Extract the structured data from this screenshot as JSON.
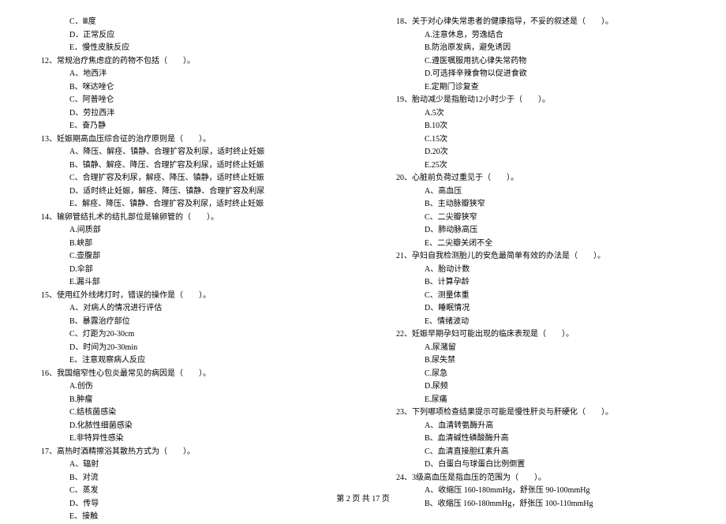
{
  "left": {
    "pre_options": [
      "C．Ⅲ度",
      "D．正常反应",
      "E．慢性皮肤反应"
    ],
    "questions": [
      {
        "num": "12、",
        "text": "常规治疗焦虑症的药物不包括（　　）。",
        "options": [
          "A、地西泮",
          "B、咪达唑仑",
          "C、阿普唑仑",
          "D、劳拉西泮",
          "E、奋乃静"
        ]
      },
      {
        "num": "13、",
        "text": "妊娠期高血压综合征的治疗原则是（　　）。",
        "options": [
          "A、降压、解痉、镇静、合理扩容及利尿，适时终止妊娠",
          "B、镇静、解痉、降压、合理扩容及利尿，适时终止妊娠",
          "C、合理扩容及利尿，解痉、降压、镇静，适时终止妊娠",
          "D、适时终止妊娠，解痉、降压、镇静、合理扩容及利尿",
          "E、解痉、降压、镇静、合理扩容及利尿，适时终止妊娠"
        ]
      },
      {
        "num": "14、",
        "text": "输卵管结扎术的结扎部位是输卵管的（　　）。",
        "options": [
          "A.间质部",
          "B.峡部",
          "C.壶腹部",
          "D.伞部",
          "E.漏斗部"
        ]
      },
      {
        "num": "15、",
        "text": "使用红外线烤灯时，错误的操作是（　　）。",
        "options": [
          "A、对病人的情况进行评估",
          "B、暴露治疗部位",
          "C、灯距为20-30cm",
          "D、时间为20-30min",
          "E、注意观察病人反应"
        ]
      },
      {
        "num": "16、",
        "text": "我国缩窄性心包炎最常见的病因是（　　）。",
        "options": [
          "A.创伤",
          "B.肿瘤",
          "C.结核菌感染",
          "D.化脓性细菌感染",
          "E.非特异性感染"
        ]
      },
      {
        "num": "17、",
        "text": "高热时酒精擦浴其散热方式为（　　）。",
        "options": [
          "A、辐射",
          "B、对流",
          "C、蒸发",
          "D、传导",
          "E、接触"
        ]
      }
    ]
  },
  "right": {
    "questions": [
      {
        "num": "18、",
        "text": "关于对心律失常患者的健康指导，不妥的叙述是（　　）。",
        "options": [
          "A.注意休息，劳逸结合",
          "B.防治原发病，避免诱因",
          "C.遵医嘱服用抗心律失常药物",
          "D.可选择辛辣食物以促进食欲",
          "E.定期门诊复查"
        ]
      },
      {
        "num": "19、",
        "text": "胎动减少是指胎动12小时少于（　　）。",
        "options": [
          "A.5次",
          "B.10次",
          "C.15次",
          "D.20次",
          "E.25次"
        ]
      },
      {
        "num": "20、",
        "text": "心脏前负荷过重见于（　　）。",
        "options": [
          "A、高血压",
          "B、主动脉瓣狭窄",
          "C、二尖瓣狭窄",
          "D、肺动脉高压",
          "E、二尖瓣关闭不全"
        ]
      },
      {
        "num": "21、",
        "text": "孕妇自我检测胎儿的安危最简单有效的办法是（　　）。",
        "options": [
          "A、胎动计数",
          "B、计算孕龄",
          "C、测量体重",
          "D、睡眠情况",
          "E、情绪波动"
        ]
      },
      {
        "num": "22、",
        "text": "妊娠早期孕妇可能出现的临床表现是（　　）。",
        "options": [
          "A.尿潴留",
          "B.尿失禁",
          "C.尿急",
          "D.尿频",
          "",
          "E.尿痛"
        ]
      },
      {
        "num": "23、",
        "text": "下列哪项检查结果提示可能是慢性肝炎与肝硬化（　　）。",
        "options": [
          "A、血清转氨酶升高",
          "B、血清碱性磷酸酶升高",
          "C、血清直接胆红素升高",
          "D、白蛋白与球蛋白比例倒置"
        ]
      },
      {
        "num": "24、",
        "text": "3级高血压是指血压的范围为（　　）。",
        "options": [
          "A、收缩压 160-180mmHg，舒张压 90-100mmHg",
          "B、收缩压 160-180mmHg，舒张压 100-110mmHg"
        ]
      }
    ]
  },
  "footer": "第 2 页 共 17 页"
}
